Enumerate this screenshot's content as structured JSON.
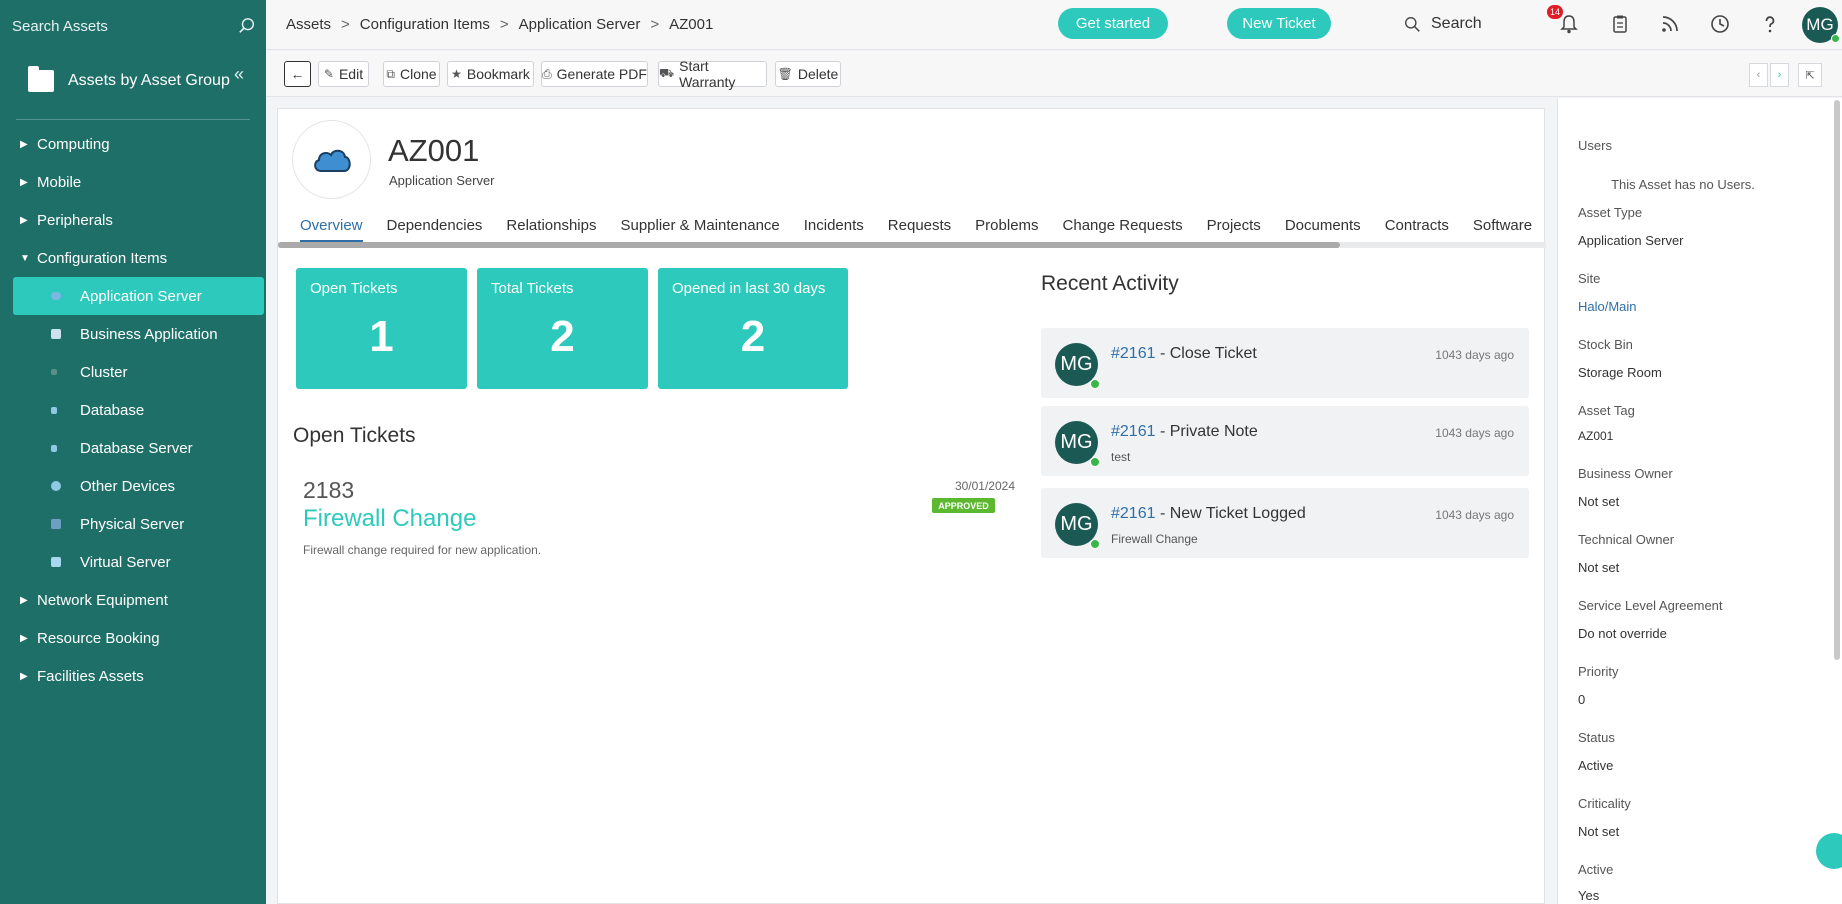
{
  "sidebar": {
    "search_placeholder": "Search Assets",
    "group_title": "Assets by Asset Group",
    "items": [
      {
        "label": "Computing",
        "expanded": false
      },
      {
        "label": "Mobile",
        "expanded": false
      },
      {
        "label": "Peripherals",
        "expanded": false
      },
      {
        "label": "Configuration Items",
        "expanded": true,
        "children": [
          {
            "label": "Application Server",
            "active": true,
            "icon": "cloud-icon"
          },
          {
            "label": "Business Application",
            "icon": "app-icon"
          },
          {
            "label": "Cluster",
            "icon": "cluster-icon"
          },
          {
            "label": "Database",
            "icon": "database-icon"
          },
          {
            "label": "Database Server",
            "icon": "database-server-icon"
          },
          {
            "label": "Other Devices",
            "icon": "device-icon"
          },
          {
            "label": "Physical Server",
            "icon": "server-icon"
          },
          {
            "label": "Virtual Server",
            "icon": "virtual-server-icon"
          }
        ]
      },
      {
        "label": "Network Equipment",
        "expanded": false
      },
      {
        "label": "Resource Booking",
        "expanded": false
      },
      {
        "label": "Facilities Assets",
        "expanded": false
      }
    ]
  },
  "breadcrumb": [
    "Assets",
    "Configuration Items",
    "Application Server",
    "AZ001"
  ],
  "topbar": {
    "get_started": "Get started",
    "new_ticket": "New Ticket",
    "search": "Search",
    "notification_count": "14",
    "user_initials": "MG"
  },
  "toolbar": {
    "edit": "Edit",
    "clone": "Clone",
    "bookmark": "Bookmark",
    "generate_pdf": "Generate PDF",
    "start_warranty": "Start Warranty",
    "delete": "Delete"
  },
  "asset": {
    "name": "AZ001",
    "type": "Application Server"
  },
  "tabs": [
    "Overview",
    "Dependencies",
    "Relationships",
    "Supplier & Maintenance",
    "Incidents",
    "Requests",
    "Problems",
    "Change Requests",
    "Projects",
    "Documents",
    "Contracts",
    "Software"
  ],
  "stats": [
    {
      "label": "Open Tickets",
      "value": "1"
    },
    {
      "label": "Total Tickets",
      "value": "2"
    },
    {
      "label": "Opened in last 30 days",
      "value": "2"
    }
  ],
  "open_tickets": {
    "heading": "Open Tickets",
    "items": [
      {
        "id": "2183",
        "title": "Firewall Change",
        "description": "Firewall change required for new application.",
        "date": "30/01/2024",
        "status": "APPROVED"
      }
    ]
  },
  "recent_activity": {
    "heading": "Recent Activity",
    "items": [
      {
        "initials": "MG",
        "ticket": "#2161",
        "action": " - Close Ticket",
        "note": "",
        "when": "1043 days ago"
      },
      {
        "initials": "MG",
        "ticket": "#2161",
        "action": " - Private Note",
        "note": "test",
        "when": "1043 days ago"
      },
      {
        "initials": "MG",
        "ticket": "#2161",
        "action": " - New Ticket Logged",
        "note": "Firewall Change",
        "when": "1043 days ago"
      }
    ]
  },
  "details": {
    "users_label": "Users",
    "users_empty": "This Asset has no Users.",
    "fields": [
      {
        "label": "Asset Type",
        "value": "Application Server"
      },
      {
        "label": "Site",
        "value": "Halo/Main"
      },
      {
        "label": "Stock Bin",
        "value": "Storage Room"
      },
      {
        "label": "Asset Tag",
        "value": "AZ001"
      },
      {
        "label": "Business Owner",
        "value": "Not set"
      },
      {
        "label": "Technical Owner",
        "value": "Not set"
      },
      {
        "label": "Service Level Agreement",
        "value": "Do not override"
      },
      {
        "label": "Priority",
        "value": "0"
      },
      {
        "label": "Status",
        "value": "Active"
      },
      {
        "label": "Criticality",
        "value": "Not set"
      },
      {
        "label": "Active",
        "value": "Yes"
      }
    ]
  },
  "colors": {
    "sidebar": "#1f6f69",
    "accent": "#2ec9bd",
    "link": "#2f6fa6",
    "approved": "#5cb82f",
    "badge": "#e01d27"
  }
}
